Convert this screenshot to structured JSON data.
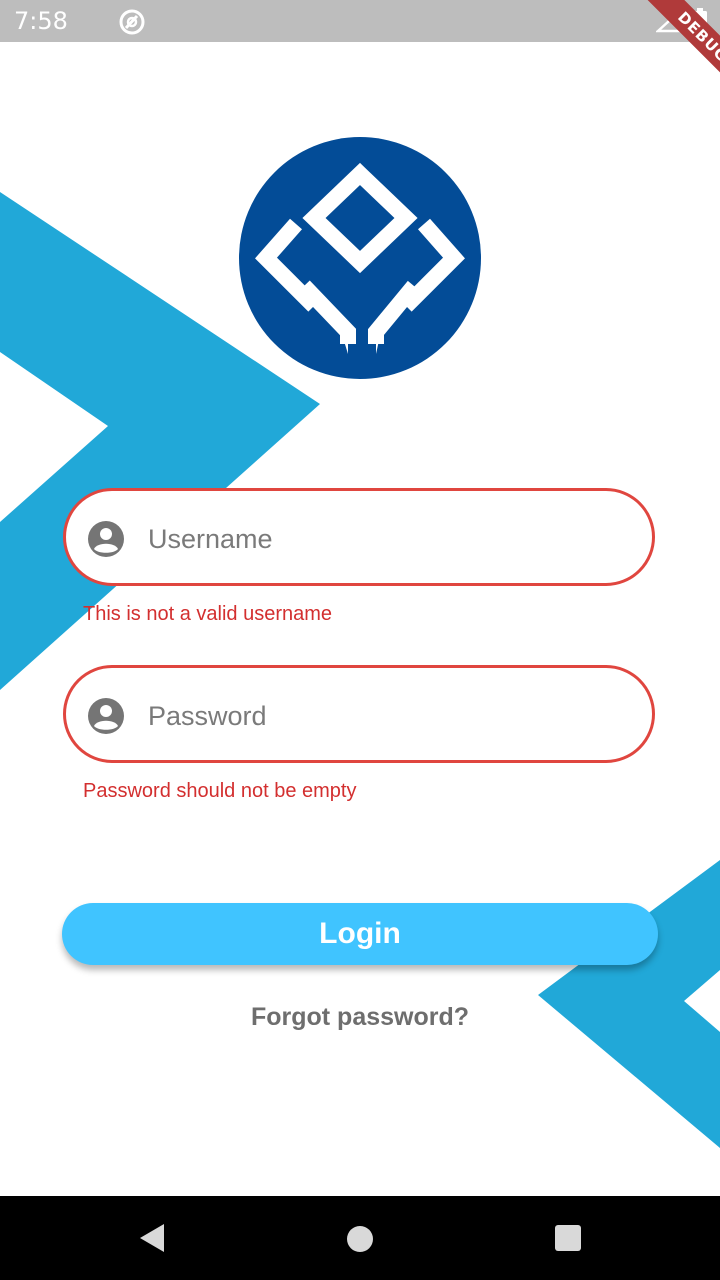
{
  "status_bar": {
    "time": "7:58"
  },
  "debug_banner": {
    "label": "DEBUG"
  },
  "login_form": {
    "username": {
      "placeholder": "Username",
      "value": "",
      "error": "This is not a valid username"
    },
    "password": {
      "placeholder": "Password",
      "value": "",
      "error": "Password should not be empty"
    },
    "login_label": "Login",
    "forgot_label": "Forgot password?"
  },
  "icons": {
    "status_app": "at-sign-icon",
    "signal": "signal-icon",
    "battery": "battery-icon",
    "username_field": "account-circle-icon",
    "password_field": "account-circle-icon",
    "nav_back": "back-triangle-icon",
    "nav_home": "home-circle-icon",
    "nav_recents": "recents-square-icon"
  },
  "colors": {
    "accent": "#40c4ff",
    "background_shape": "#21a8d8",
    "logo_blue": "#034c97",
    "error": "#e0463f",
    "error_text": "#d32f2f",
    "status_bar": "#bdbdbd",
    "debug_ribbon": "#b03a3a"
  }
}
